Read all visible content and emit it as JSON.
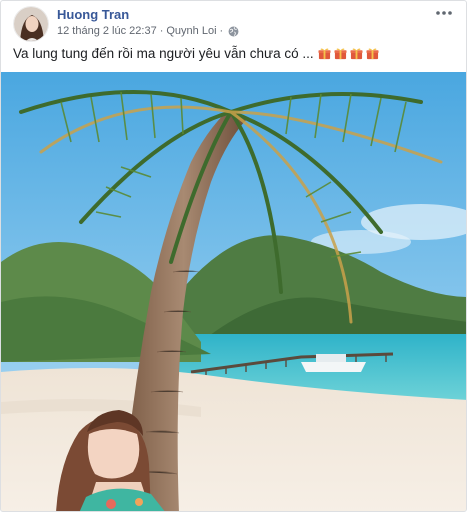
{
  "post": {
    "author": "Huong Tran",
    "timestamp": "12 tháng 2 lúc 22:37",
    "separator": "·",
    "location": "Quynh Loi",
    "privacy_icon": "globe-icon",
    "more_icon": "more-dots-icon",
    "caption": "Va lung tung đến rồi ma người yêu vẫn chưa có ...",
    "caption_emoji": [
      "gift-icon",
      "gift-icon",
      "gift-icon",
      "gift-icon"
    ]
  },
  "colors": {
    "author_link": "#385898",
    "meta_text": "#616770",
    "gift_red": "#e0583c",
    "gift_ribbon": "#f5c24c"
  }
}
